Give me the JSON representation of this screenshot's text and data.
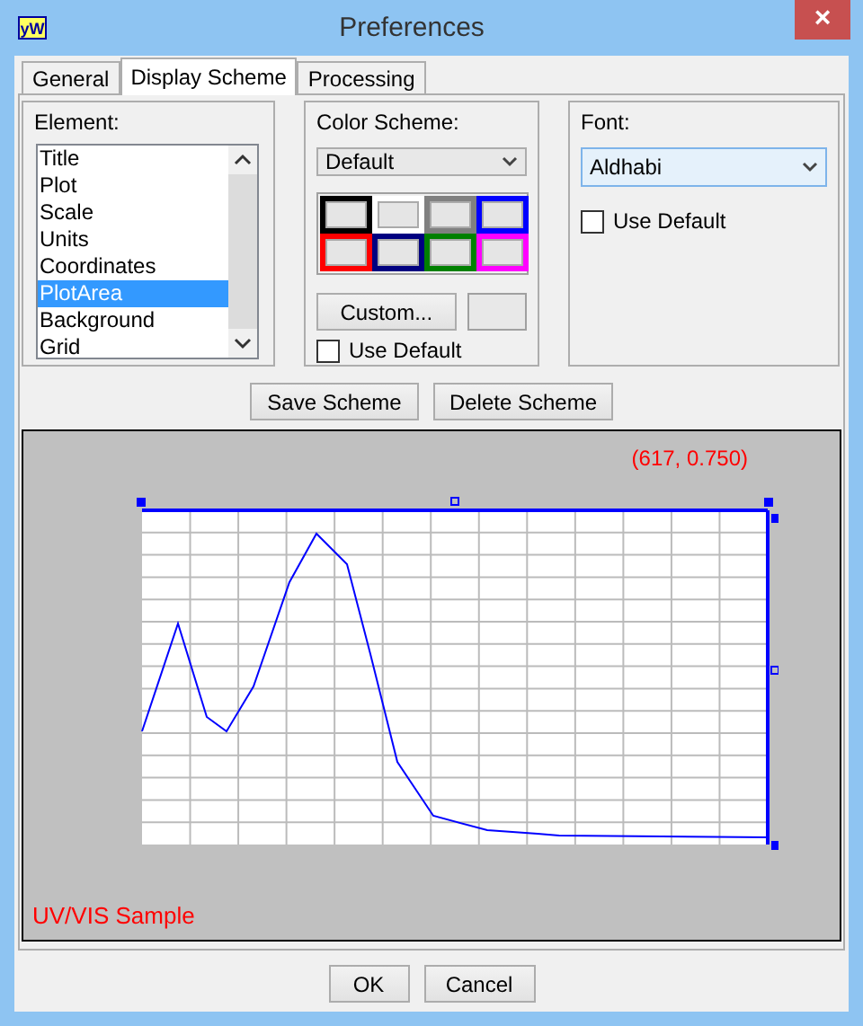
{
  "window": {
    "icon_text": "yW",
    "title": "Preferences",
    "close": "×"
  },
  "tabs": [
    {
      "label": "General",
      "selected": false
    },
    {
      "label": "Display Scheme",
      "selected": true
    },
    {
      "label": "Processing",
      "selected": false
    }
  ],
  "element": {
    "label": "Element:",
    "items": [
      {
        "label": "Title",
        "selected": false
      },
      {
        "label": "Plot",
        "selected": false
      },
      {
        "label": "Scale",
        "selected": false
      },
      {
        "label": "Units",
        "selected": false
      },
      {
        "label": "Coordinates",
        "selected": false
      },
      {
        "label": "PlotArea",
        "selected": true
      },
      {
        "label": "Background",
        "selected": false
      },
      {
        "label": "Grid",
        "selected": false
      }
    ]
  },
  "color_scheme": {
    "label": "Color Scheme:",
    "value": "Default",
    "swatches": [
      {
        "color": "#000000"
      },
      {
        "color": "#ffffff"
      },
      {
        "color": "#808080"
      },
      {
        "color": "#0000ff"
      },
      {
        "color": "#ff0000"
      },
      {
        "color": "#000080"
      },
      {
        "color": "#008000"
      },
      {
        "color": "#ff00ff"
      }
    ],
    "custom_button": "Custom...",
    "use_default": {
      "label": "Use Default",
      "checked": false
    }
  },
  "font": {
    "label": "Font:",
    "value": "Aldhabi",
    "use_default": {
      "label": "Use Default",
      "checked": false
    }
  },
  "scheme_buttons": [
    "Save Scheme",
    "Delete Scheme"
  ],
  "preview": {
    "coordinates": "(617, 0.750)",
    "caption": "UV/VIS Sample"
  },
  "buttons": [
    "OK",
    "Cancel"
  ]
}
